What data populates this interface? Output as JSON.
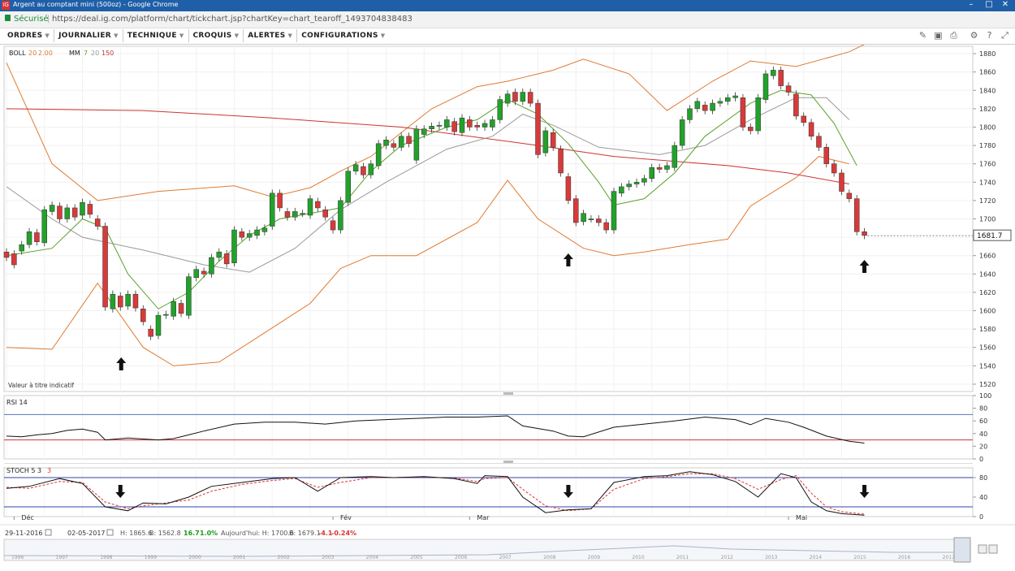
{
  "window": {
    "title": "Argent au comptant mini (500oz) - Google Chrome",
    "logo": "IG"
  },
  "address": {
    "secure_label": "Sécurisé",
    "url": "https://deal.ig.com/platform/chart/tickchart.jsp?chartKey=chart_tearoff_1493704838483"
  },
  "menu": [
    {
      "label": "ORDRES"
    },
    {
      "label": "JOURNALIER"
    },
    {
      "label": "TECHNIQUE"
    },
    {
      "label": "CROQUIS"
    },
    {
      "label": "ALERTES"
    },
    {
      "label": "CONFIGURATIONS"
    }
  ],
  "toolbar_icons": [
    "draw-icon",
    "screenshot-icon",
    "print-icon",
    "settings-icon",
    "help-icon",
    "expand-icon"
  ],
  "indicators": {
    "boll": {
      "name": "BOLL",
      "p1": "20",
      "p2": "2.00"
    },
    "mm": {
      "name": "MM",
      "p1": "7",
      "p2": "20",
      "p3": "150"
    },
    "disclaimer": "Valeur à titre indicatif",
    "rsi": {
      "name": "RSI",
      "p1": "14"
    },
    "stoch": {
      "name": "STOCH",
      "p1": "5",
      "p2": "3",
      "p3": "3"
    }
  },
  "current_price": "1681.7",
  "status": {
    "date_from": "29-11-2016",
    "date_to": "02-05-2017",
    "high_label": "H:",
    "high": "1865.6",
    "low_label": "B:",
    "low": "1562.8",
    "change": "16.7",
    "change_pct": "1.0%",
    "today_label": "Aujourd'hui:",
    "today_high": "1700.6",
    "today_low": "1679.1",
    "today_change": "-4.1",
    "today_change_pct": "-0.24%"
  },
  "colors": {
    "up": "#22a12b",
    "down": "#d83a3a",
    "boll": "#e07a30",
    "mm7": "#5aa02c",
    "mm20": "#999999",
    "mm150": "#cc3333"
  },
  "chart_data": {
    "type": "candlestick",
    "price_axis": {
      "ticks": [
        1880,
        1860,
        1840,
        1820,
        1800,
        1780,
        1760,
        1740,
        1720,
        1700,
        1680,
        1660,
        1640,
        1620,
        1600,
        1580,
        1560,
        1540,
        1520
      ],
      "ylim": [
        1512,
        1888
      ]
    },
    "month_labels": [
      {
        "label": "Déc",
        "index": 1
      },
      {
        "label": "Fév",
        "index": 43
      },
      {
        "label": "Mar",
        "index": 61
      },
      {
        "label": "Mai",
        "index": 103
      }
    ],
    "candles": [
      [
        1664,
        1658
      ],
      [
        1662,
        1650
      ],
      [
        1665,
        1672
      ],
      [
        1672,
        1686
      ],
      [
        1685,
        1675
      ],
      [
        1674,
        1710
      ],
      [
        1708,
        1715
      ],
      [
        1714,
        1700
      ],
      [
        1700,
        1712
      ],
      [
        1712,
        1702
      ],
      [
        1704,
        1718
      ],
      [
        1716,
        1705
      ],
      [
        1700,
        1692
      ],
      [
        1692,
        1604
      ],
      [
        1602,
        1618
      ],
      [
        1616,
        1604
      ],
      [
        1605,
        1618
      ],
      [
        1618,
        1603
      ],
      [
        1602,
        1588
      ],
      [
        1580,
        1572
      ],
      [
        1573,
        1595
      ],
      [
        1595,
        1596
      ],
      [
        1594,
        1610
      ],
      [
        1608,
        1597
      ],
      [
        1595,
        1637
      ],
      [
        1636,
        1645
      ],
      [
        1643,
        1640
      ],
      [
        1640,
        1658
      ],
      [
        1658,
        1664
      ],
      [
        1662,
        1651
      ],
      [
        1652,
        1688
      ],
      [
        1686,
        1680
      ],
      [
        1680,
        1684
      ],
      [
        1682,
        1688
      ],
      [
        1686,
        1690
      ],
      [
        1692,
        1728
      ],
      [
        1728,
        1712
      ],
      [
        1708,
        1702
      ],
      [
        1702,
        1708
      ],
      [
        1706,
        1706
      ],
      [
        1704,
        1722
      ],
      [
        1719,
        1712
      ],
      [
        1710,
        1702
      ],
      [
        1698,
        1688
      ],
      [
        1688,
        1720
      ],
      [
        1718,
        1752
      ],
      [
        1752,
        1759
      ],
      [
        1757,
        1748
      ],
      [
        1748,
        1760
      ],
      [
        1758,
        1782
      ],
      [
        1780,
        1786
      ],
      [
        1782,
        1778
      ],
      [
        1778,
        1790
      ],
      [
        1790,
        1782
      ],
      [
        1764,
        1798
      ],
      [
        1792,
        1798
      ],
      [
        1798,
        1801
      ],
      [
        1801,
        1802
      ],
      [
        1800,
        1808
      ],
      [
        1806,
        1795
      ],
      [
        1794,
        1810
      ],
      [
        1808,
        1800
      ],
      [
        1802,
        1800
      ],
      [
        1800,
        1804
      ],
      [
        1800,
        1808
      ],
      [
        1808,
        1830
      ],
      [
        1826,
        1836
      ],
      [
        1838,
        1828
      ],
      [
        1828,
        1838
      ],
      [
        1838,
        1826
      ],
      [
        1826,
        1770
      ],
      [
        1772,
        1796
      ],
      [
        1794,
        1778
      ],
      [
        1776,
        1750
      ],
      [
        1746,
        1720
      ],
      [
        1722,
        1696
      ],
      [
        1697,
        1706
      ],
      [
        1700,
        1700
      ],
      [
        1700,
        1696
      ],
      [
        1696,
        1688
      ],
      [
        1688,
        1730
      ],
      [
        1728,
        1735
      ],
      [
        1735,
        1738
      ],
      [
        1738,
        1740
      ],
      [
        1740,
        1744
      ],
      [
        1744,
        1756
      ],
      [
        1756,
        1754
      ],
      [
        1754,
        1758
      ],
      [
        1756,
        1780
      ],
      [
        1780,
        1808
      ],
      [
        1808,
        1820
      ],
      [
        1820,
        1828
      ],
      [
        1824,
        1818
      ],
      [
        1818,
        1826
      ],
      [
        1826,
        1828
      ],
      [
        1828,
        1832
      ],
      [
        1832,
        1834
      ],
      [
        1832,
        1800
      ],
      [
        1800,
        1796
      ],
      [
        1796,
        1832
      ],
      [
        1830,
        1858
      ],
      [
        1856,
        1862
      ],
      [
        1862,
        1845
      ],
      [
        1845,
        1838
      ],
      [
        1836,
        1812
      ],
      [
        1812,
        1805
      ],
      [
        1805,
        1790
      ],
      [
        1790,
        1778
      ],
      [
        1778,
        1760
      ],
      [
        1760,
        1750
      ],
      [
        1750,
        1730
      ],
      [
        1728,
        1722
      ],
      [
        1722,
        1686
      ],
      [
        1686,
        1682
      ]
    ],
    "mm150": [
      [
        0,
        1820
      ],
      [
        18,
        1818
      ],
      [
        35,
        1810
      ],
      [
        52,
        1800
      ],
      [
        70,
        1780
      ],
      [
        80,
        1768
      ],
      [
        95,
        1758
      ],
      [
        103,
        1750
      ],
      [
        111,
        1738
      ]
    ],
    "boll_upper": [
      [
        0,
        1870
      ],
      [
        6,
        1760
      ],
      [
        12,
        1720
      ],
      [
        20,
        1730
      ],
      [
        30,
        1736
      ],
      [
        35,
        1724
      ],
      [
        40,
        1734
      ],
      [
        44,
        1752
      ],
      [
        48,
        1768
      ],
      [
        56,
        1820
      ],
      [
        62,
        1844
      ],
      [
        66,
        1850
      ],
      [
        72,
        1862
      ],
      [
        76,
        1874
      ],
      [
        82,
        1858
      ],
      [
        87,
        1818
      ],
      [
        93,
        1850
      ],
      [
        98,
        1872
      ],
      [
        104,
        1866
      ],
      [
        111,
        1882
      ],
      [
        113,
        1890
      ]
    ],
    "boll_lower": [
      [
        0,
        1560
      ],
      [
        6,
        1558
      ],
      [
        12,
        1630
      ],
      [
        18,
        1560
      ],
      [
        22,
        1540
      ],
      [
        28,
        1544
      ],
      [
        34,
        1576
      ],
      [
        40,
        1608
      ],
      [
        44,
        1646
      ],
      [
        48,
        1660
      ],
      [
        54,
        1660
      ],
      [
        62,
        1696
      ],
      [
        66,
        1742
      ],
      [
        70,
        1700
      ],
      [
        76,
        1668
      ],
      [
        80,
        1660
      ],
      [
        84,
        1664
      ],
      [
        90,
        1672
      ],
      [
        95,
        1678
      ],
      [
        98,
        1714
      ],
      [
        104,
        1745
      ],
      [
        107,
        1768
      ],
      [
        111,
        1760
      ]
    ],
    "mm20": [
      [
        0,
        1735
      ],
      [
        6,
        1700
      ],
      [
        10,
        1680
      ],
      [
        18,
        1666
      ],
      [
        26,
        1650
      ],
      [
        32,
        1642
      ],
      [
        38,
        1668
      ],
      [
        44,
        1710
      ],
      [
        50,
        1740
      ],
      [
        58,
        1776
      ],
      [
        64,
        1790
      ],
      [
        68,
        1814
      ],
      [
        72,
        1802
      ],
      [
        78,
        1778
      ],
      [
        86,
        1770
      ],
      [
        92,
        1780
      ],
      [
        98,
        1808
      ],
      [
        104,
        1832
      ],
      [
        108,
        1832
      ],
      [
        111,
        1808
      ]
    ],
    "mm7": [
      [
        0,
        1660
      ],
      [
        6,
        1668
      ],
      [
        10,
        1700
      ],
      [
        13,
        1690
      ],
      [
        16,
        1640
      ],
      [
        20,
        1602
      ],
      [
        24,
        1620
      ],
      [
        28,
        1654
      ],
      [
        32,
        1682
      ],
      [
        36,
        1700
      ],
      [
        40,
        1706
      ],
      [
        44,
        1712
      ],
      [
        48,
        1752
      ],
      [
        52,
        1780
      ],
      [
        58,
        1800
      ],
      [
        62,
        1808
      ],
      [
        66,
        1830
      ],
      [
        70,
        1814
      ],
      [
        74,
        1782
      ],
      [
        78,
        1740
      ],
      [
        80,
        1715
      ],
      [
        84,
        1722
      ],
      [
        88,
        1750
      ],
      [
        92,
        1790
      ],
      [
        98,
        1826
      ],
      [
        102,
        1840
      ],
      [
        106,
        1835
      ],
      [
        109,
        1804
      ],
      [
        112,
        1758
      ]
    ],
    "rsi": {
      "ticks": [
        100,
        80,
        60,
        40,
        20,
        0
      ],
      "ylim": [
        0,
        100
      ],
      "levels": [
        70,
        30
      ],
      "values": [
        [
          0,
          36
        ],
        [
          2,
          35
        ],
        [
          4,
          38
        ],
        [
          6,
          40
        ],
        [
          8,
          45
        ],
        [
          10,
          47
        ],
        [
          12,
          42
        ],
        [
          13,
          30
        ],
        [
          16,
          33
        ],
        [
          20,
          30
        ],
        [
          22,
          32
        ],
        [
          24,
          38
        ],
        [
          26,
          44
        ],
        [
          30,
          55
        ],
        [
          34,
          58
        ],
        [
          38,
          58
        ],
        [
          42,
          55
        ],
        [
          46,
          60
        ],
        [
          50,
          62
        ],
        [
          54,
          64
        ],
        [
          58,
          66
        ],
        [
          62,
          66
        ],
        [
          66,
          68
        ],
        [
          68,
          52
        ],
        [
          72,
          44
        ],
        [
          74,
          36
        ],
        [
          76,
          35
        ],
        [
          80,
          50
        ],
        [
          84,
          55
        ],
        [
          88,
          60
        ],
        [
          92,
          66
        ],
        [
          96,
          62
        ],
        [
          98,
          54
        ],
        [
          100,
          64
        ],
        [
          103,
          58
        ],
        [
          105,
          50
        ],
        [
          108,
          36
        ],
        [
          111,
          28
        ],
        [
          113,
          25
        ]
      ]
    },
    "stoch": {
      "ticks": [
        80,
        40,
        0
      ],
      "ylim": [
        0,
        100
      ],
      "levels": [
        80,
        20
      ],
      "k": [
        [
          0,
          58
        ],
        [
          3,
          62
        ],
        [
          7,
          78
        ],
        [
          10,
          68
        ],
        [
          13,
          20
        ],
        [
          16,
          12
        ],
        [
          18,
          28
        ],
        [
          21,
          26
        ],
        [
          24,
          40
        ],
        [
          27,
          62
        ],
        [
          31,
          70
        ],
        [
          35,
          78
        ],
        [
          38,
          80
        ],
        [
          41,
          52
        ],
        [
          44,
          80
        ],
        [
          48,
          82
        ],
        [
          51,
          80
        ],
        [
          55,
          82
        ],
        [
          59,
          78
        ],
        [
          62,
          68
        ],
        [
          63,
          84
        ],
        [
          66,
          82
        ],
        [
          68,
          40
        ],
        [
          71,
          8
        ],
        [
          74,
          14
        ],
        [
          77,
          16
        ],
        [
          80,
          70
        ],
        [
          84,
          82
        ],
        [
          87,
          84
        ],
        [
          90,
          92
        ],
        [
          93,
          86
        ],
        [
          96,
          72
        ],
        [
          99,
          40
        ],
        [
          102,
          88
        ],
        [
          104,
          80
        ],
        [
          106,
          30
        ],
        [
          108,
          12
        ],
        [
          110,
          6
        ],
        [
          113,
          3
        ]
      ],
      "d": [
        [
          0,
          60
        ],
        [
          3,
          58
        ],
        [
          7,
          72
        ],
        [
          10,
          70
        ],
        [
          13,
          30
        ],
        [
          16,
          16
        ],
        [
          18,
          22
        ],
        [
          21,
          28
        ],
        [
          24,
          34
        ],
        [
          27,
          52
        ],
        [
          31,
          66
        ],
        [
          35,
          74
        ],
        [
          38,
          78
        ],
        [
          41,
          60
        ],
        [
          44,
          70
        ],
        [
          48,
          80
        ],
        [
          51,
          80
        ],
        [
          55,
          81
        ],
        [
          59,
          79
        ],
        [
          62,
          72
        ],
        [
          63,
          78
        ],
        [
          66,
          80
        ],
        [
          68,
          56
        ],
        [
          71,
          22
        ],
        [
          74,
          12
        ],
        [
          77,
          16
        ],
        [
          80,
          56
        ],
        [
          84,
          78
        ],
        [
          87,
          82
        ],
        [
          90,
          88
        ],
        [
          93,
          88
        ],
        [
          96,
          78
        ],
        [
          99,
          56
        ],
        [
          102,
          76
        ],
        [
          104,
          84
        ],
        [
          106,
          48
        ],
        [
          108,
          20
        ],
        [
          110,
          10
        ],
        [
          113,
          5
        ]
      ]
    },
    "arrows": [
      {
        "index": 15,
        "dir": "up"
      },
      {
        "index": 74,
        "dir": "up"
      },
      {
        "index": 113,
        "dir": "up"
      }
    ],
    "stoch_arrows": [
      {
        "index": 15,
        "dir": "down"
      },
      {
        "index": 74,
        "dir": "down"
      },
      {
        "index": 113,
        "dir": "down"
      }
    ],
    "navigator_years": [
      "1996",
      "1997",
      "1998",
      "1999",
      "2000",
      "2001",
      "2002",
      "2003",
      "2004",
      "2005",
      "2006",
      "2007",
      "2008",
      "2009",
      "2010",
      "2011",
      "2012",
      "2013",
      "2014",
      "2015",
      "2016",
      "2017"
    ]
  }
}
